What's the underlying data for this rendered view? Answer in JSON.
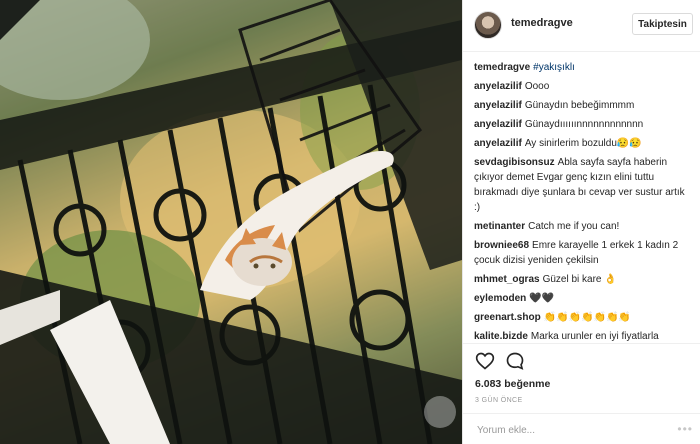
{
  "post": {
    "username": "temedragve",
    "follow_label": "Takiptesin",
    "caption_user": "temedragve",
    "caption_tag": "#yakışıklı",
    "likes": "6.083 beğenme",
    "date": "3 GÜN ÖNCE",
    "comment_placeholder": "Yorum ekle...",
    "more_icon": "more-dots-icon"
  },
  "comments": [
    {
      "user": "anyelazilif",
      "text": "Oooo"
    },
    {
      "user": "anyelazilif",
      "text": "Günaydın bebeğimmmm"
    },
    {
      "user": "anyelazilif",
      "text": "Günaydıııııınnnnnnnnnnnn"
    },
    {
      "user": "anyelazilif",
      "text": "Ay sinirlerim bozuldu😥😥"
    },
    {
      "user": "sevdagibisonsuz",
      "text": "Abla sayfa sayfa haberin çıkıyor demet Evgar genç kızın elini tuttu bırakmadı diye şunlara bı cevap ver sustur artık :)"
    },
    {
      "user": "metinanter",
      "text": "Catch me if you can!"
    },
    {
      "user": "browniee68",
      "text": "Emre karayelle 1 erkek 1 kadın 2 çocuk dizisi yeniden çekilsin"
    },
    {
      "user": "mhmet_ogras",
      "text": "Güzel bi kare 👌"
    },
    {
      "user": "eylemoden",
      "text": "🖤🖤"
    },
    {
      "user": "greenart.shop",
      "text": "👏👏👏👏👏👏👏"
    },
    {
      "user": "kalite.bizde",
      "text": "Marka urunler en iyi fiyatlarla burada"
    }
  ]
}
